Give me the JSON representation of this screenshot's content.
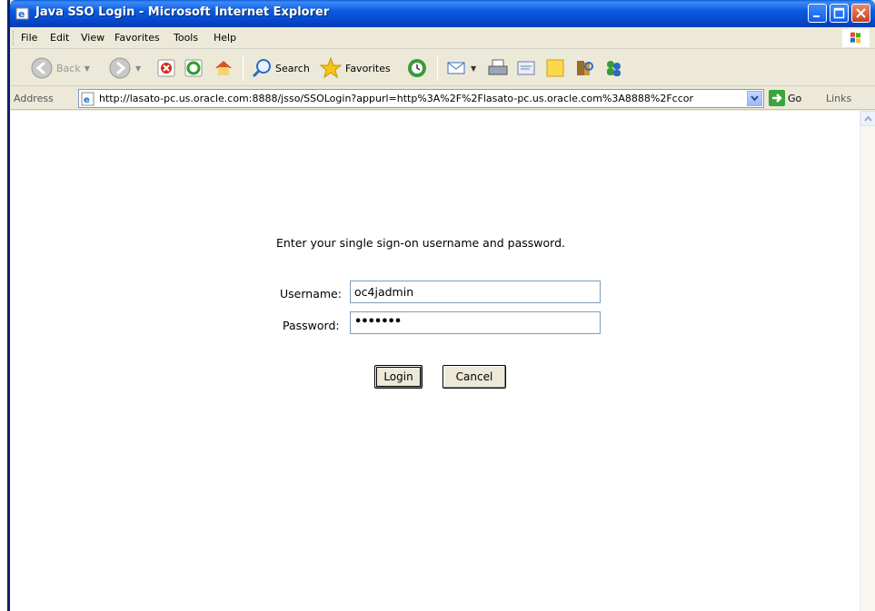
{
  "window": {
    "title": "Java SSO Login - Microsoft Internet Explorer"
  },
  "menu": {
    "items": [
      "File",
      "Edit",
      "View",
      "Favorites",
      "Tools",
      "Help"
    ]
  },
  "toolbar": {
    "back_label": "Back",
    "search_label": "Search",
    "favorites_label": "Favorites"
  },
  "address": {
    "label": "Address",
    "url": "http://lasato-pc.us.oracle.com:8888/jsso/SSOLogin?appurl=http%3A%2F%2Flasato-pc.us.oracle.com%3A8888%2Fccor",
    "go_label": "Go",
    "links_label": "Links"
  },
  "login": {
    "prompt": "Enter your single sign-on username and password.",
    "username_label": "Username:",
    "username_value": "oc4jadmin",
    "password_label": "Password:",
    "password_value": "•••••••",
    "login_button": "Login",
    "cancel_button": "Cancel"
  },
  "colors": {
    "titlebar": "#0b5be0",
    "chrome": "#ece9d8",
    "field_border": "#7f9db9"
  }
}
